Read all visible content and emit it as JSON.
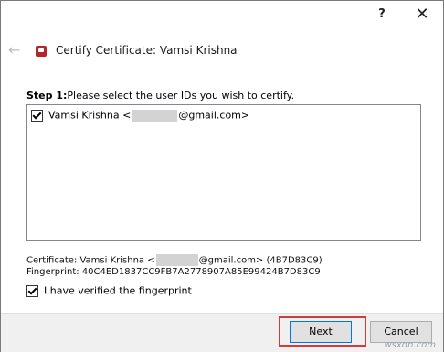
{
  "titlebar": {
    "help_label": "?",
    "close_label": "✕"
  },
  "header": {
    "title": "Certify Certificate: Vamsi Krishna",
    "back_icon": "back-arrow-icon",
    "cert_icon": "certificate-icon",
    "accent_color": "#b3262b"
  },
  "step": {
    "label": "Step 1:",
    "text": "Please select the user IDs you wish to certify."
  },
  "user_ids": [
    {
      "name_prefix": "Vamsi Krishna <",
      "email_suffix": "@gmail.com>",
      "checked": true
    }
  ],
  "certificate": {
    "prefix": "Certificate: Vamsi Krishna <",
    "suffix": "@gmail.com> (4B7D83C9)"
  },
  "fingerprint": {
    "text": "Fingerprint: 40C4ED1837CC9FB7A2778907A85E99424B7D83C9"
  },
  "verify": {
    "label": "I have verified the fingerprint",
    "checked": true
  },
  "footer": {
    "next_label": "Next",
    "cancel_label": "Cancel",
    "highlight_color": "#d23c3c"
  },
  "watermark": "wsxdn.com"
}
